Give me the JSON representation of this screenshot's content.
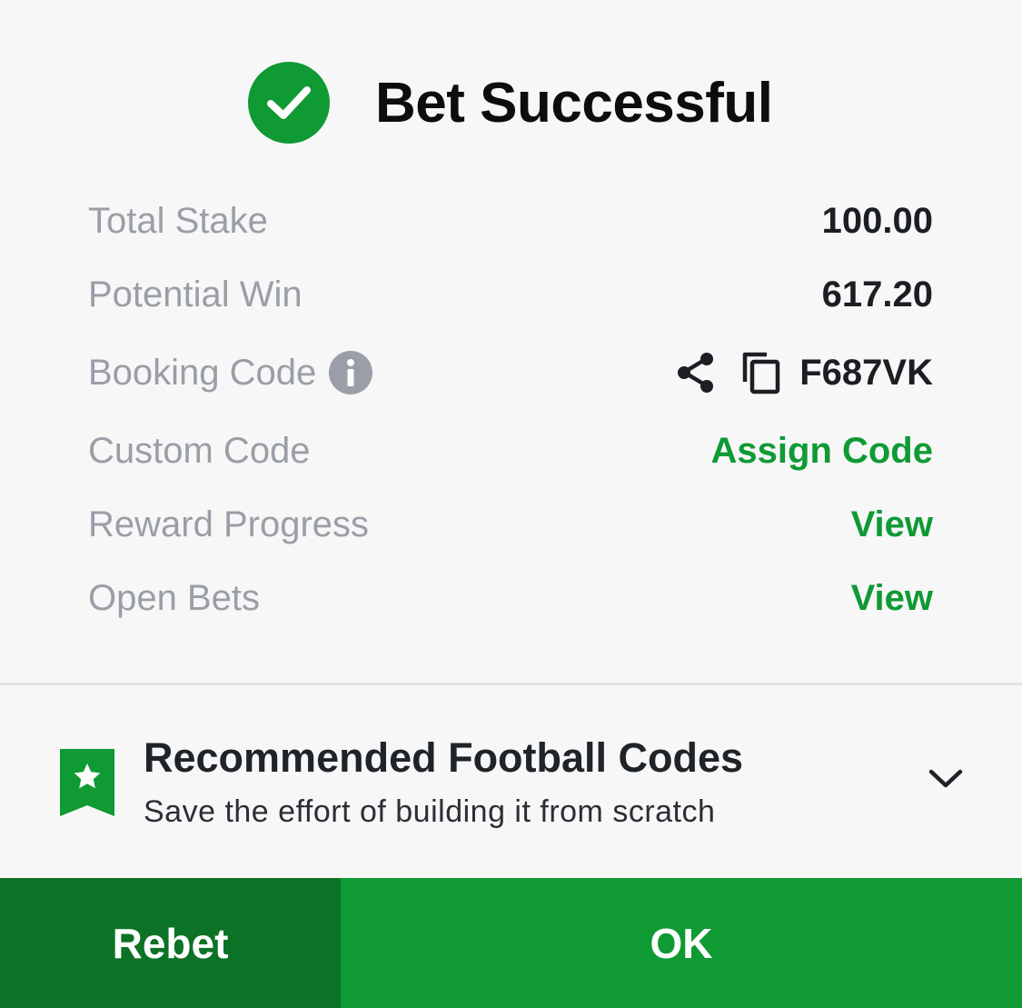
{
  "header": {
    "title": "Bet Successful",
    "icon": "check-circle-icon"
  },
  "summary": {
    "total_stake": {
      "label": "Total Stake",
      "value": "100.00"
    },
    "potential_win": {
      "label": "Potential Win",
      "value": "617.20"
    },
    "booking_code": {
      "label": "Booking Code",
      "value": "F687VK",
      "icons": [
        "info-icon",
        "share-icon",
        "copy-icon"
      ]
    },
    "custom_code": {
      "label": "Custom Code",
      "action": "Assign Code"
    },
    "reward_progress": {
      "label": "Reward Progress",
      "action": "View"
    },
    "open_bets": {
      "label": "Open Bets",
      "action": "View"
    }
  },
  "recommendation": {
    "title": "Recommended Football Codes",
    "subtitle": "Save the effort of building it from scratch",
    "icon": "bookmark-star-icon",
    "expand_icon": "chevron-down-icon"
  },
  "footer": {
    "rebet_label": "Rebet",
    "ok_label": "OK"
  },
  "colors": {
    "brand_green": "#0f9a34",
    "dark_green": "#0c7226",
    "label_gray": "#9a9ea6",
    "value_dark": "#1b1e23",
    "background": "#f7f7f8"
  }
}
